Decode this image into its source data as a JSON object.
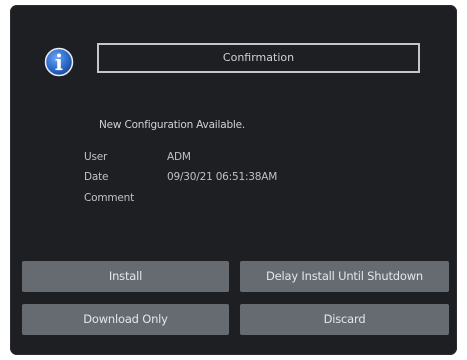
{
  "dialog": {
    "title": "Confirmation",
    "icon": "info-icon",
    "message": "New Configuration Available.",
    "fields": [
      {
        "label": "User",
        "value": "ADM"
      },
      {
        "label": "Date",
        "value": "09/30/21 06:51:38AM"
      },
      {
        "label": "Comment",
        "value": ""
      }
    ],
    "buttons": {
      "install": "Install",
      "delay": "Delay Install Until Shutdown",
      "download": "Download Only",
      "discard": "Discard"
    }
  },
  "colors": {
    "background": "#1d1f23",
    "button": "#666b72",
    "icon": "#2f6fd0"
  }
}
